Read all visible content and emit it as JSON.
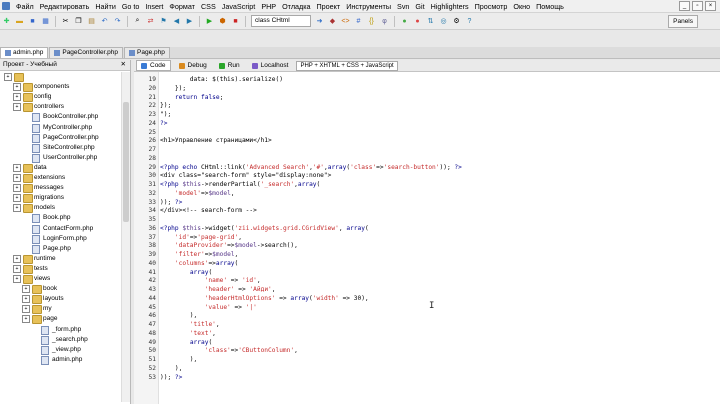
{
  "menubar": {
    "items": [
      "Файл",
      "Редактировать",
      "Найти",
      "Go to",
      "Insert",
      "Формат",
      "CSS",
      "JavaScript",
      "PHP",
      "Отладка",
      "Проект",
      "Инструменты",
      "Svn",
      "Git",
      "Highlighters",
      "Просмотр",
      "Окно",
      "Помощь"
    ]
  },
  "toolbar": {
    "class_select": "class CHtml",
    "panels_label": "Panels"
  },
  "file_tabs": [
    {
      "label": "admin.php",
      "active": true
    },
    {
      "label": "PageController.php",
      "active": false
    },
    {
      "label": "Page.php",
      "active": false
    }
  ],
  "project_panel": {
    "title": "Проект - Учебный",
    "tree": [
      {
        "label": "",
        "type": "folder",
        "indent": 0
      },
      {
        "label": "components",
        "type": "folder",
        "indent": 1
      },
      {
        "label": "config",
        "type": "folder",
        "indent": 1
      },
      {
        "label": "controllers",
        "type": "folder",
        "indent": 1
      },
      {
        "label": "BookController.php",
        "type": "file",
        "indent": 2
      },
      {
        "label": "MyController.php",
        "type": "file",
        "indent": 2
      },
      {
        "label": "PageController.php",
        "type": "file",
        "indent": 2
      },
      {
        "label": "SiteController.php",
        "type": "file",
        "indent": 2
      },
      {
        "label": "UserController.php",
        "type": "file",
        "indent": 2
      },
      {
        "label": "data",
        "type": "folder",
        "indent": 1
      },
      {
        "label": "extensions",
        "type": "folder",
        "indent": 1
      },
      {
        "label": "messages",
        "type": "folder",
        "indent": 1
      },
      {
        "label": "migrations",
        "type": "folder",
        "indent": 1
      },
      {
        "label": "models",
        "type": "folder",
        "indent": 1
      },
      {
        "label": "Book.php",
        "type": "file",
        "indent": 2
      },
      {
        "label": "ContactForm.php",
        "type": "file",
        "indent": 2
      },
      {
        "label": "LoginForm.php",
        "type": "file",
        "indent": 2
      },
      {
        "label": "Page.php",
        "type": "file",
        "indent": 2
      },
      {
        "label": "runtime",
        "type": "folder",
        "indent": 1
      },
      {
        "label": "tests",
        "type": "folder",
        "indent": 1
      },
      {
        "label": "views",
        "type": "folder",
        "indent": 1
      },
      {
        "label": "book",
        "type": "folder",
        "indent": 2
      },
      {
        "label": "layouts",
        "type": "folder",
        "indent": 2
      },
      {
        "label": "my",
        "type": "folder",
        "indent": 2
      },
      {
        "label": "page",
        "type": "folder",
        "indent": 2
      },
      {
        "label": "_form.php",
        "type": "file",
        "indent": 3
      },
      {
        "label": "_search.php",
        "type": "file",
        "indent": 3
      },
      {
        "label": "_view.php",
        "type": "file",
        "indent": 3
      },
      {
        "label": "admin.php",
        "type": "file",
        "indent": 3
      }
    ]
  },
  "editor": {
    "tabs": [
      {
        "label": "Code",
        "active": true
      },
      {
        "label": "Debug",
        "active": false
      },
      {
        "label": "Run",
        "active": false
      },
      {
        "label": "Localhost",
        "active": false
      }
    ],
    "mode_select": "PHP + XHTML + CSS + JavaScript",
    "lines": [
      {
        "n": "19",
        "text": "        data: $(this).serialize()"
      },
      {
        "n": "20",
        "text": "    });"
      },
      {
        "n": "21",
        "text": "    return false;"
      },
      {
        "n": "22",
        "text": "});"
      },
      {
        "n": "23",
        "text": "\");"
      },
      {
        "n": "24",
        "text": "?>"
      },
      {
        "n": "25",
        "text": ""
      },
      {
        "n": "26",
        "text": "<h1>Управление страницами</h1>"
      },
      {
        "n": "27",
        "text": ""
      },
      {
        "n": "28",
        "text": ""
      },
      {
        "n": "29",
        "text": "<?php echo CHtml::link('Advanced Search','#',array('class'=>'search-button')); ?>"
      },
      {
        "n": "30",
        "text": "<div class=\"search-form\" style=\"display:none\">"
      },
      {
        "n": "31",
        "text": "<?php $this->renderPartial('_search',array("
      },
      {
        "n": "32",
        "text": "    'model'=>$model,"
      },
      {
        "n": "33",
        "text": ")); ?>"
      },
      {
        "n": "34",
        "text": "</div><!-- search-form -->"
      },
      {
        "n": "35",
        "text": ""
      },
      {
        "n": "36",
        "text": "<?php $this->widget('zii.widgets.grid.CGridView', array("
      },
      {
        "n": "37",
        "text": "    'id'=>'page-grid',"
      },
      {
        "n": "38",
        "text": "    'dataProvider'=>$model->search(),"
      },
      {
        "n": "39",
        "text": "    'filter'=>$model,"
      },
      {
        "n": "40",
        "text": "    'columns'=>array("
      },
      {
        "n": "41",
        "text": "        array("
      },
      {
        "n": "42",
        "text": "            'name' => 'id',"
      },
      {
        "n": "43",
        "text": "            'header' => 'Айди',"
      },
      {
        "n": "44",
        "text": "            'headerHtmlOptions' => array('width' => 30),"
      },
      {
        "n": "45",
        "text": "            'value' => '|'"
      },
      {
        "n": "46",
        "text": "        ),"
      },
      {
        "n": "47",
        "text": "        'title',"
      },
      {
        "n": "48",
        "text": "        'text',"
      },
      {
        "n": "49",
        "text": "        array("
      },
      {
        "n": "50",
        "text": "            'class'=>'CButtonColumn',"
      },
      {
        "n": "51",
        "text": "        ),"
      },
      {
        "n": "52",
        "text": "    ),"
      },
      {
        "n": "53",
        "text": ")); ?>"
      }
    ]
  },
  "colors": {
    "keyword": "#00008b",
    "string": "#c52b2b",
    "variable": "#5a3a8a",
    "folder": "#e7c158"
  }
}
